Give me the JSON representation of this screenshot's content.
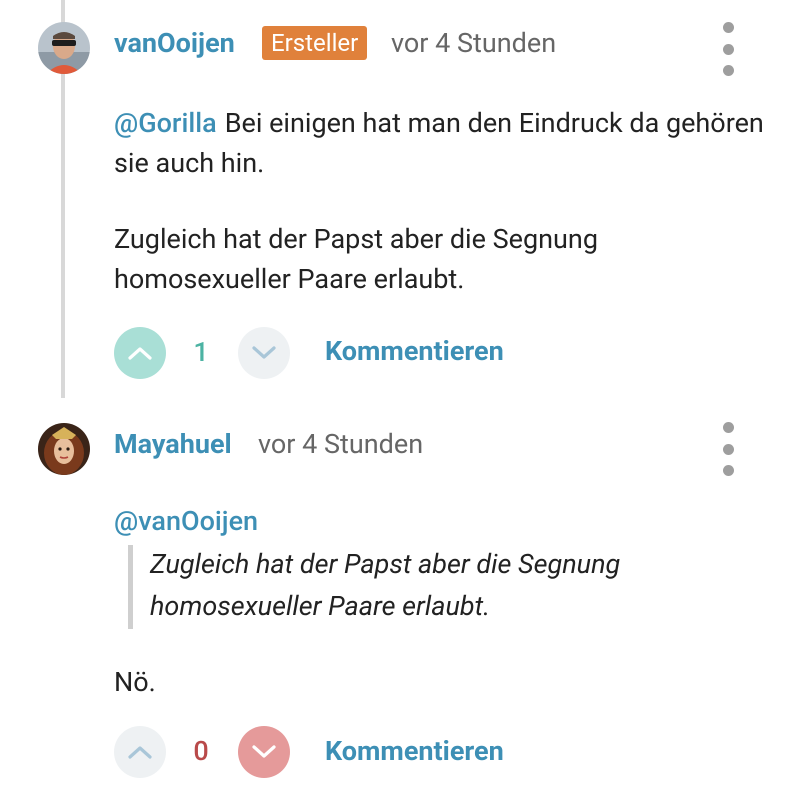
{
  "comments": [
    {
      "author": "vanOoijen",
      "badge": "Ersteller",
      "time": "vor 4 Stunden",
      "mention": "@Gorilla",
      "paragraph1": "Bei einigen hat man den Eindruck da gehören sie auch hin.",
      "paragraph2": "Zugleich hat der Papst aber die Segnung homosexueller Paare erlaubt.",
      "votes": "1",
      "upvoted": true,
      "comment_label": "Kommentieren"
    },
    {
      "author": "Mayahuel",
      "time": "vor 4 Stunden",
      "quote_mention": "@vanOoijen",
      "quote_text": "Zugleich hat der Papst aber die Segnung homosexueller Paare erlaubt.",
      "body": "Nö.",
      "votes": "0",
      "downvoted": true,
      "comment_label": "Kommentieren"
    }
  ],
  "colors": {
    "accent": "#3d8fb5",
    "badge": "#e0813b",
    "upvote_active": "#a9dfd6",
    "downvote_active": "#e59a9a",
    "vote_inactive": "#eef1f3",
    "upvote_count": "#4cb3a3",
    "downvote_count": "#b94a4a"
  }
}
